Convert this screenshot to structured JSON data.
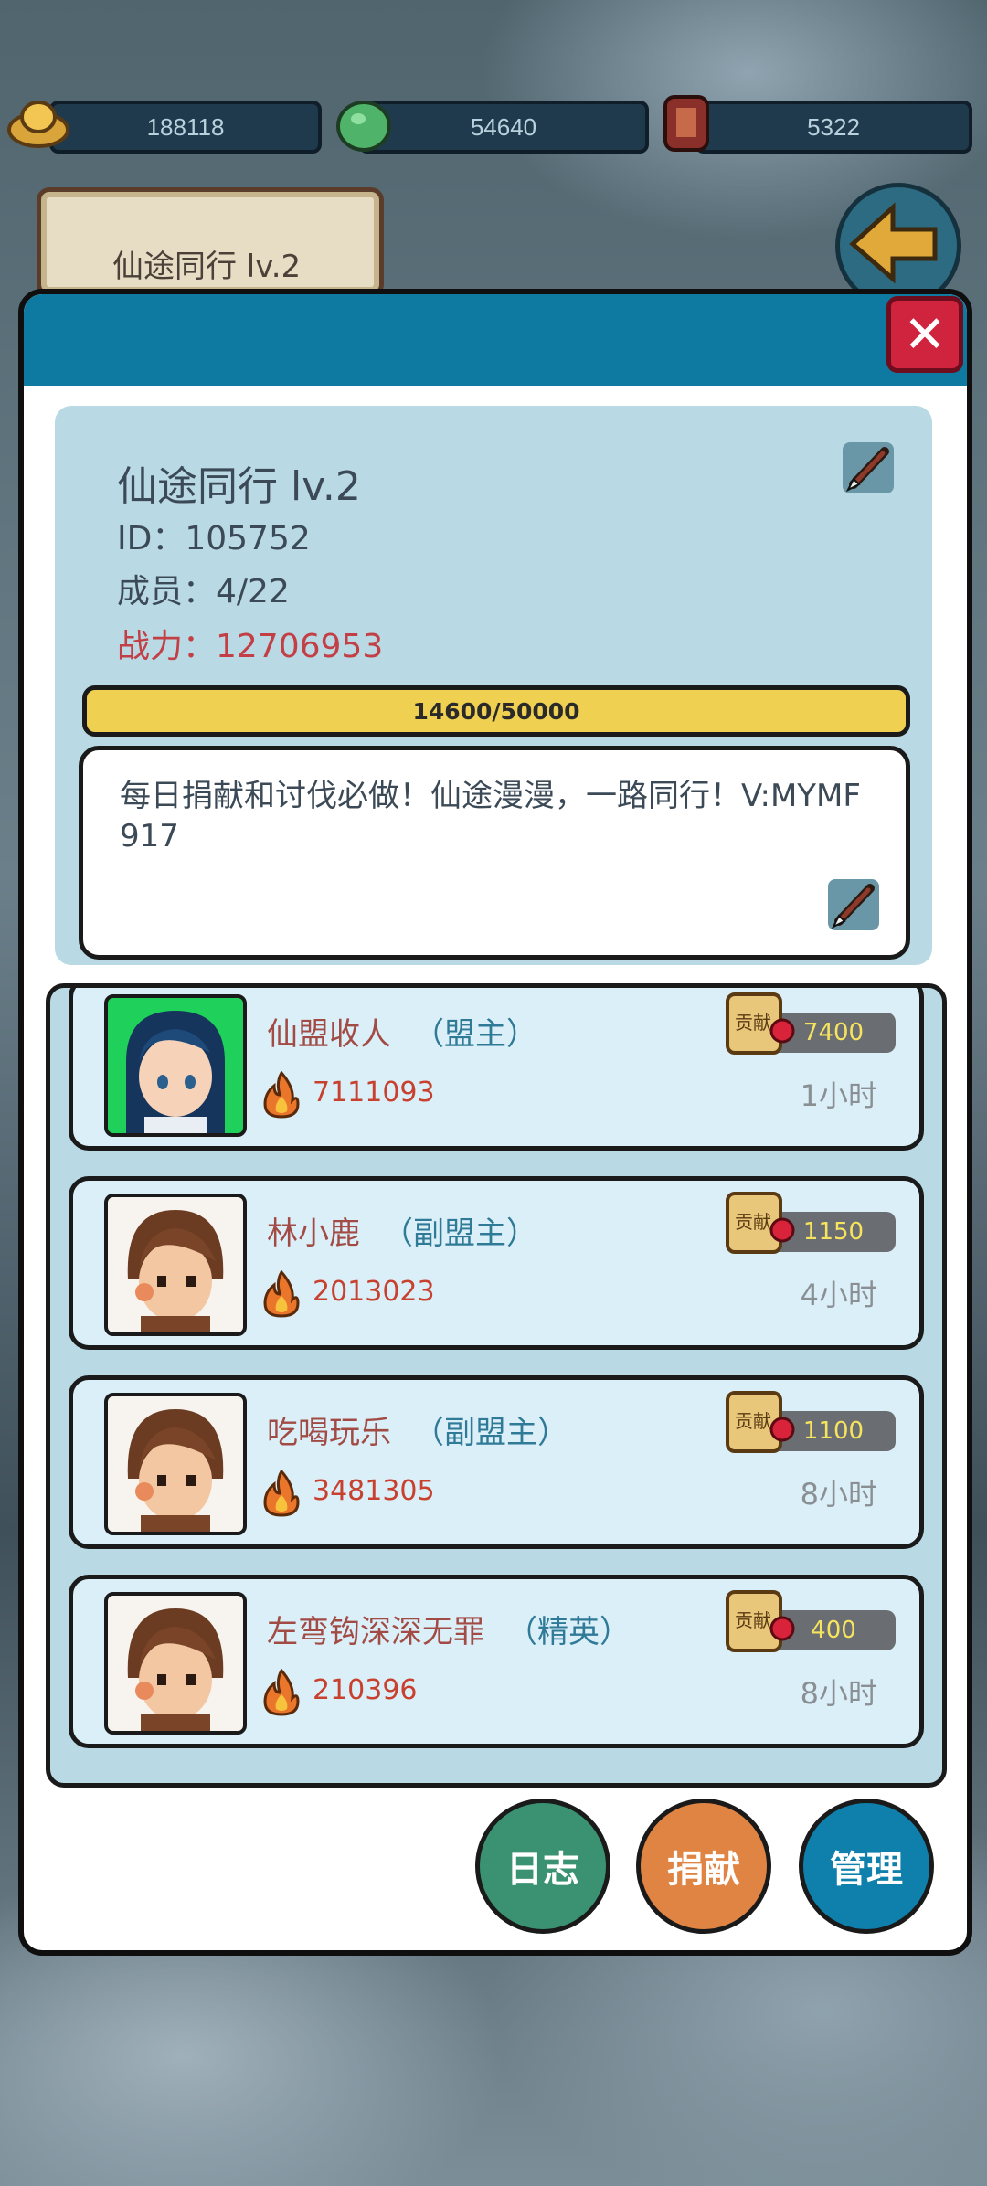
{
  "resources": [
    {
      "icon": "gold-ingot-icon",
      "value": "188118"
    },
    {
      "icon": "jade-stone-icon",
      "value": "54640"
    },
    {
      "icon": "talisman-bag-icon",
      "value": "5322"
    }
  ],
  "header": {
    "scroll_title": "仙途同行 lv.2"
  },
  "guild": {
    "name": "仙途同行 lv.2",
    "id_line": "ID：105752",
    "members_line": "成员：4/22",
    "power_line": "战力：12706953",
    "progress_text": "14600/50000",
    "progress_value": 0.292,
    "notice": "每日捐献和讨伐必做！仙途漫漫，一路同行！V:MYMF917"
  },
  "members": [
    {
      "name": "仙盟收人",
      "role": "（盟主）",
      "power": "7111093",
      "contribution": "7400",
      "time": "1小时",
      "avatar": "leader-avatar"
    },
    {
      "name": "林小鹿",
      "role": "（副盟主）",
      "power": "2013023",
      "contribution": "1150",
      "time": "4小时",
      "avatar": "member-avatar"
    },
    {
      "name": "吃喝玩乐",
      "role": "（副盟主）",
      "power": "3481305",
      "contribution": "1100",
      "time": "8小时",
      "avatar": "member-avatar"
    },
    {
      "name": "左弯钩深深无罪",
      "role": "（精英）",
      "power": "210396",
      "contribution": "400",
      "time": "8小时",
      "avatar": "member-avatar"
    }
  ],
  "contrib_scroll_text": "贡献",
  "buttons": {
    "log": "日志",
    "donate": "捐献",
    "manage": "管理"
  },
  "colors": {
    "header": "#0e7aa2",
    "log": "#3a9272",
    "donate": "#e08443",
    "manage": "#0f7fab",
    "progress": "#f0d050"
  }
}
